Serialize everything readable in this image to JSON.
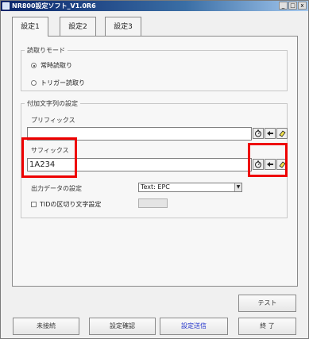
{
  "window": {
    "title": "NR800設定ソフト_V1.0R6",
    "controls": [
      "_",
      "□",
      "x"
    ]
  },
  "tabs": [
    {
      "label": "設定1",
      "active": true
    },
    {
      "label": "設定2",
      "active": false
    },
    {
      "label": "設定3",
      "active": false
    }
  ],
  "read_mode": {
    "legend": "読取りモード",
    "options": [
      {
        "label": "常時読取り",
        "selected": true
      },
      {
        "label": "トリガー読取り",
        "selected": false
      }
    ]
  },
  "append": {
    "legend": "付加文字列の設定",
    "prefix_label": "プリフィックス",
    "prefix_value": "",
    "suffix_label": "サフィックス",
    "suffix_value": "1A234",
    "output_label": "出力データの設定",
    "output_value": "Text: EPC",
    "tid_label": "TIDの区切り文字設定"
  },
  "buttons": {
    "test": "テスト",
    "disconnected": "未接続",
    "confirm": "設定確認",
    "send": "設定送信",
    "exit": "終 了"
  },
  "colors": {
    "highlight": "#ee0000",
    "send_text": "#2233cc"
  }
}
